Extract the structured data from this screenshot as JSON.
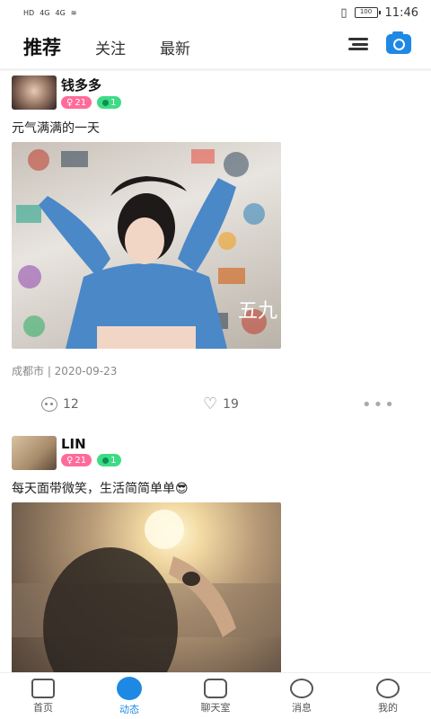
{
  "status": {
    "left_labels": [
      "HD",
      "4G",
      "4G"
    ],
    "battery": "100",
    "time": "11:46"
  },
  "tabs": [
    {
      "label": "推荐",
      "active": true
    },
    {
      "label": "关注",
      "active": false
    },
    {
      "label": "最新",
      "active": false
    }
  ],
  "header_icons": [
    "menu-icon",
    "camera-icon"
  ],
  "posts": [
    {
      "username": "钱多多",
      "badge_female": "21",
      "badge_level": "1",
      "text": "元气满满的一天",
      "image_text": "五九",
      "location": "成都市 | 2020-09-23",
      "comments": "12",
      "likes": "19"
    },
    {
      "username": "LIN",
      "badge_female": "21",
      "badge_level": "1",
      "text": "每天面带微笑，生活简简单单😎"
    }
  ],
  "bottom_nav": [
    {
      "label": "首页",
      "icon": "home-icon",
      "active": false
    },
    {
      "label": "动态",
      "icon": "feed-icon",
      "active": true
    },
    {
      "label": "聊天室",
      "icon": "chat-room-icon",
      "active": false
    },
    {
      "label": "消息",
      "icon": "message-icon",
      "active": false
    },
    {
      "label": "我的",
      "icon": "profile-icon",
      "active": false
    }
  ],
  "colors": {
    "accent": "#1e88e5",
    "female_badge": "#ff6b9a",
    "level_badge": "#3ddc84"
  }
}
